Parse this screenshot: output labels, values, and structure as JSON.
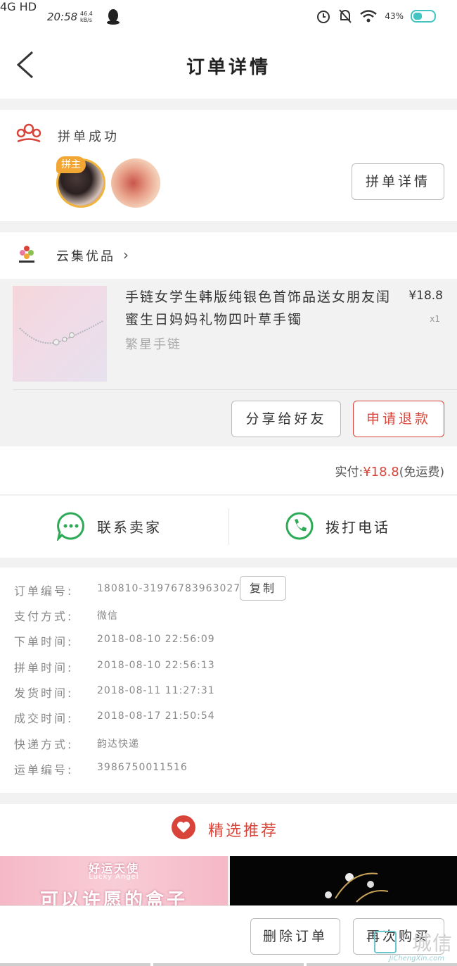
{
  "status_bar": {
    "network": "4G HD",
    "time": "20:58",
    "speed": "46.4 kB/s",
    "battery": "43%"
  },
  "header": {
    "title": "订单详情"
  },
  "group": {
    "status": "拼单成功",
    "leader_badge": "拼主",
    "detail_button": "拼单详情"
  },
  "store": {
    "name": "云集优品"
  },
  "product": {
    "title": "手链女学生韩版纯银色首饰品送女朋友闺蜜生日妈妈礼物四叶草手镯",
    "spec": "繁星手链",
    "price": "¥18.8",
    "quantity": "x1"
  },
  "actions": {
    "share": "分享给好友",
    "refund": "申请退款"
  },
  "payment": {
    "label": "实付:",
    "amount": "¥18.8",
    "note": "(免运费)"
  },
  "contact": {
    "seller": "联系卖家",
    "phone": "拨打电话"
  },
  "order_info": {
    "copy_button": "复制",
    "rows": [
      {
        "label": "订单编号:",
        "value": "180810-319767839630279"
      },
      {
        "label": "支付方式:",
        "value": "微信"
      },
      {
        "label": "下单时间:",
        "value": "2018-08-10 22:56:09"
      },
      {
        "label": "拼单时间:",
        "value": "2018-08-10 22:56:13"
      },
      {
        "label": "发货时间:",
        "value": "2018-08-11 11:27:31"
      },
      {
        "label": "成交时间:",
        "value": "2018-08-17 21:50:54"
      },
      {
        "label": "快递方式:",
        "value": "韵达快递"
      },
      {
        "label": "运单编号:",
        "value": "3986750011516"
      }
    ]
  },
  "recommend": {
    "title": "精选推荐",
    "banner_left": {
      "line1": "好运天使",
      "line2": "Lucky Angel",
      "line3": "可以许愿的盒子"
    }
  },
  "bottom": {
    "delete": "删除订单",
    "rebuy": "再次购买",
    "watermark": "城信",
    "watermark_sub": "JiChengXin.com"
  },
  "colors": {
    "accent": "#d9443a",
    "leader": "#f2a634",
    "wechat_green": "#2daa55"
  }
}
